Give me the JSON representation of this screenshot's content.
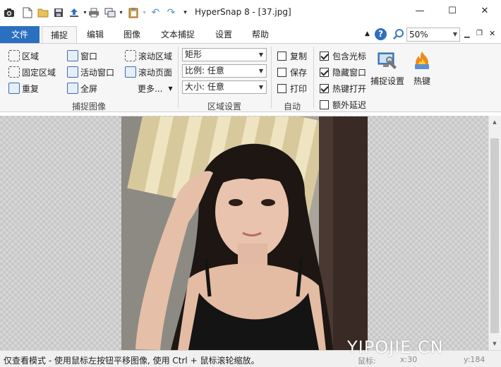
{
  "app": {
    "title": "HyperSnap 8 - [37.jpg]"
  },
  "quick_access": {
    "icons": [
      "camera-icon",
      "new-file-icon",
      "open-folder-icon",
      "save-icon",
      "upload-icon",
      "print-icon",
      "copy-window-icon",
      "paste-icon",
      "undo-icon",
      "redo-icon",
      "customize-icon"
    ]
  },
  "window_controls": {
    "minimize": "—",
    "maximize": "☐",
    "close": "✕"
  },
  "tabs": [
    {
      "label": "文件"
    },
    {
      "label": "捕捉"
    },
    {
      "label": "编辑"
    },
    {
      "label": "图像"
    },
    {
      "label": "文本捕捉"
    },
    {
      "label": "设置"
    },
    {
      "label": "帮助"
    }
  ],
  "zoom": {
    "value": "50%"
  },
  "capture_group": {
    "label": "捕捉图像",
    "buttons": [
      {
        "label": "区域"
      },
      {
        "label": "固定区域"
      },
      {
        "label": "重复"
      },
      {
        "label": "窗口"
      },
      {
        "label": "活动窗口"
      },
      {
        "label": "全屏"
      },
      {
        "label": "滚动区域"
      },
      {
        "label": "滚动页面"
      },
      {
        "label": "更多..."
      }
    ]
  },
  "region_settings": {
    "label": "区域设置",
    "shape": "矩形",
    "ratio": "比例: 任意",
    "size": "大小: 任意"
  },
  "auto_group": {
    "label": "自动",
    "options": [
      {
        "label": "复制",
        "checked": false
      },
      {
        "label": "保存",
        "checked": false
      },
      {
        "label": "打印",
        "checked": false
      }
    ]
  },
  "options_group": {
    "options": [
      {
        "label": "包含光标",
        "checked": true
      },
      {
        "label": "隐藏窗口",
        "checked": true
      },
      {
        "label": "热键打开",
        "checked": true
      },
      {
        "label": "额外延迟",
        "checked": false
      }
    ]
  },
  "big_buttons": [
    {
      "label": "捕捉设置"
    },
    {
      "label": "热键"
    }
  ],
  "status": {
    "text": "仅查看模式 - 使用鼠标左按钮平移图像, 使用 Ctrl + 鼠标滚轮缩放。",
    "coords_label": "鼠标:",
    "x": "x:30",
    "y": "y:184"
  },
  "watermark": "YIPOJIE.CN",
  "colors": {
    "file_tab": "#2b6fc0",
    "ribbon_bg": "#f6f6f6"
  }
}
